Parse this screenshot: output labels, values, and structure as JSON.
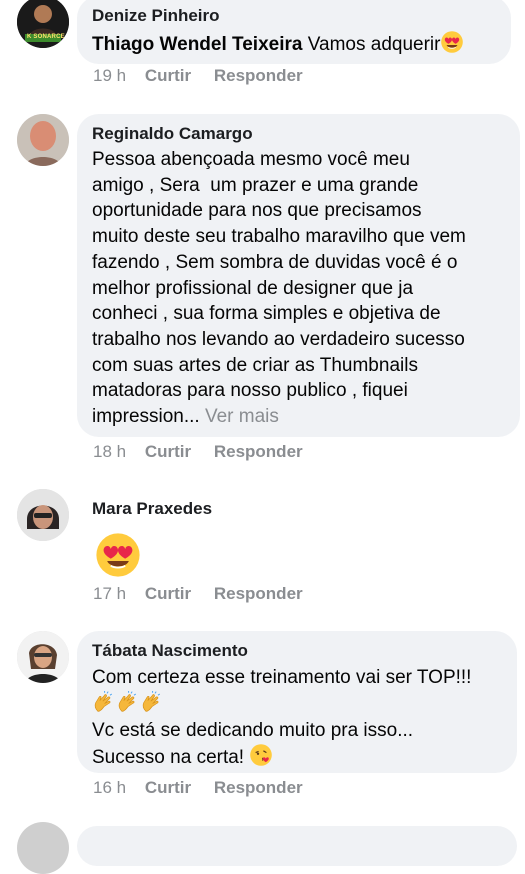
{
  "comments": [
    {
      "author": "Denize Pinheiro",
      "mention": "Thiago Wendel Teixeira",
      "text": " Vamos adquerir",
      "emoji": "heart-eyes",
      "time": "19 h",
      "like": "Curtir",
      "reply": "Responder",
      "avatar_badge": "K SONARCE"
    },
    {
      "author": "Reginaldo Camargo",
      "lines": [
        "Pessoa abençoada mesmo você meu",
        "amigo , Sera  um prazer e uma grande",
        "oportunidade para nos que precisamos",
        "muito deste seu trabalho maravilho que vem",
        "fazendo , Sem sombra de duvidas você é o",
        "melhor profissional de designer que ja",
        "conheci , sua forma simples e objetiva de",
        "trabalho nos levando ao verdadeiro sucesso",
        "com suas artes de criar as Thumbnails",
        "matadoras para nosso publico , fiquei",
        "impression..."
      ],
      "see_more": "Ver mais",
      "time": "18 h",
      "like": "Curtir",
      "reply": "Responder"
    },
    {
      "author": "Mara Praxedes",
      "emoji": "heart-eyes",
      "time": "17 h",
      "like": "Curtir",
      "reply": "Responder"
    },
    {
      "author": "Tábata Nascimento",
      "line1": "Com certeza esse treinamento vai ser TOP!!!",
      "line2_emoji": "clapping-hands x3",
      "line3": "Vc está se dedicando muito pra isso...",
      "line4": "Sucesso na certa! ",
      "line4_emoji": "face-blowing-kiss",
      "time": "16 h",
      "like": "Curtir",
      "reply": "Responder"
    }
  ],
  "colors": {
    "bubble": "#f0f2f5",
    "meta": "#8a8d91",
    "text": "#050505"
  }
}
